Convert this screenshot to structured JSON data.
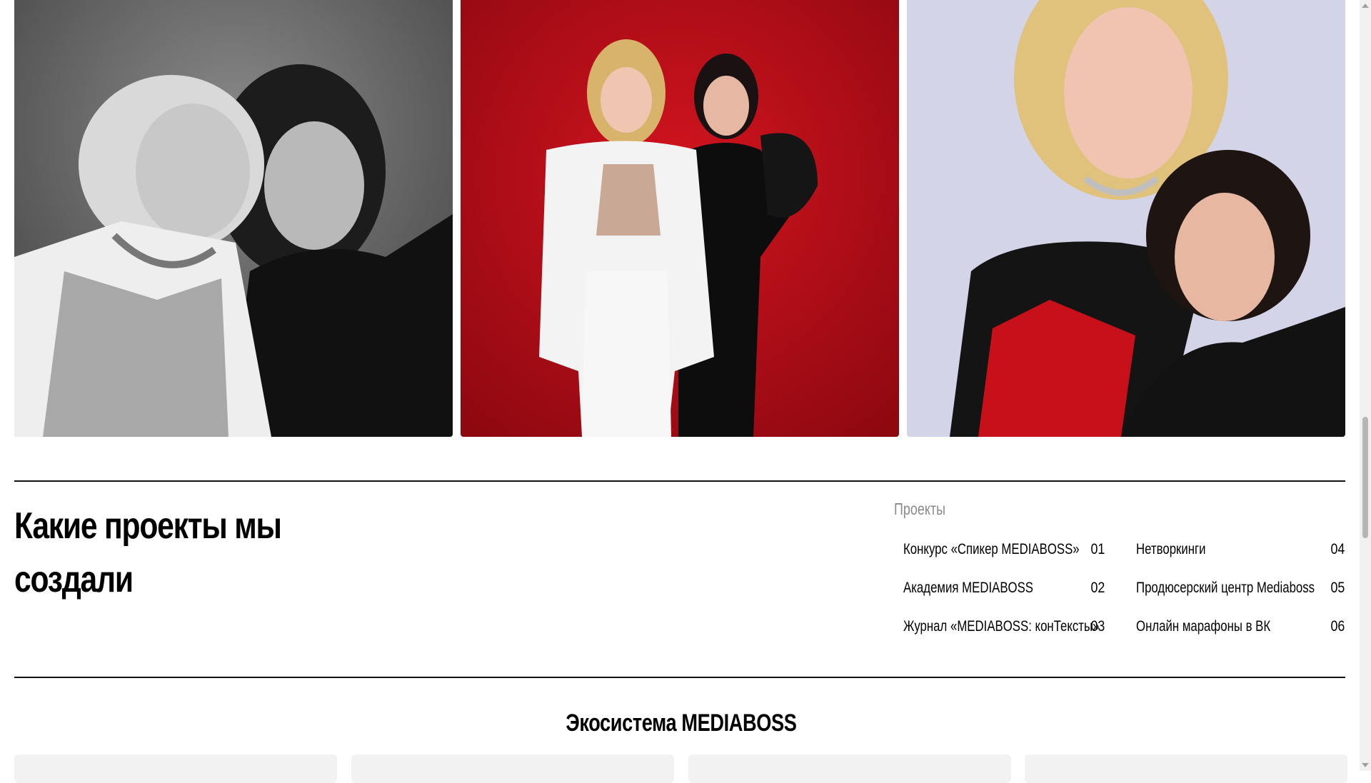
{
  "photos": [
    {
      "name": "bw-portrait",
      "alt": ""
    },
    {
      "name": "red-background-portrait",
      "alt": ""
    },
    {
      "name": "lavender-background-portrait",
      "alt": ""
    }
  ],
  "section": {
    "heading_line1": "Какие проекты мы",
    "heading_line2": "создали",
    "projects_label": "Проекты",
    "projects": [
      {
        "title": "Конкурс «Спикер MEDIABOSS»",
        "num": "01"
      },
      {
        "title": "Академия MEDIABOSS",
        "num": "02"
      },
      {
        "title": "Журнал «MEDIABOSS: конТексты»",
        "num": "03"
      },
      {
        "title": "Нетворкинги",
        "num": "04"
      },
      {
        "title": "Продюсерский центр Mediaboss",
        "num": "05"
      },
      {
        "title": "Онлайн марафоны в ВК",
        "num": "06"
      }
    ]
  },
  "ecosystem": {
    "title": "Экосистема MEDIABOSS"
  },
  "colors": {
    "accent_red": "#c1121c",
    "rule": "#111111",
    "muted_label": "#8a8a8a"
  }
}
